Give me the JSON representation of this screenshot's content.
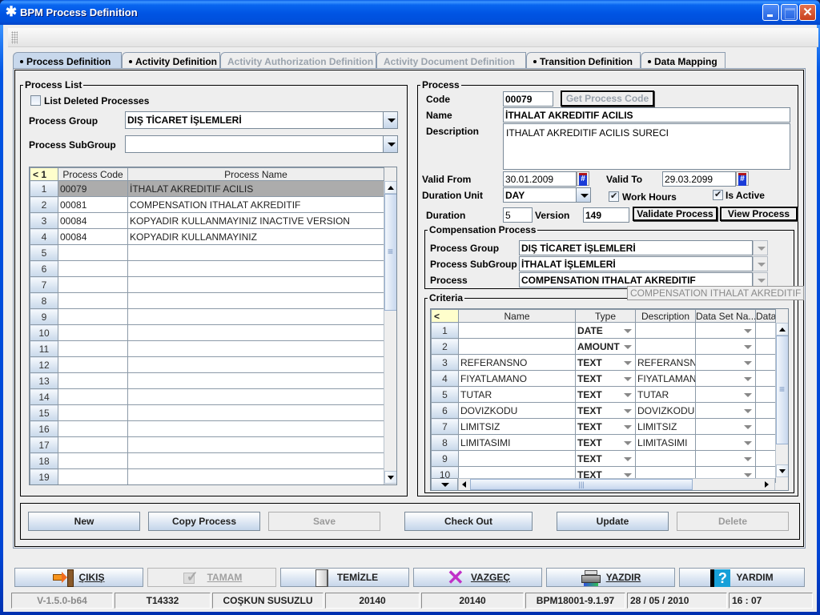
{
  "window": {
    "title": "BPM Process Definition",
    "controls": [
      "minimize",
      "maximize",
      "close"
    ]
  },
  "tabs": [
    {
      "label": "Process Definition",
      "state": "active"
    },
    {
      "label": "Activity Definition",
      "state": "enabled"
    },
    {
      "label": "Activity Authorization Definition",
      "state": "disabled"
    },
    {
      "label": "Activity Document Definition",
      "state": "disabled"
    },
    {
      "label": "Transition Definition",
      "state": "enabled"
    },
    {
      "label": "Data Mapping",
      "state": "enabled"
    }
  ],
  "process_list": {
    "legend": "Process List",
    "list_deleted_label": "List Deleted Processes",
    "list_deleted_checked": false,
    "group_label": "Process Group",
    "group_value": "DIŞ TİCARET İŞLEMLERİ",
    "subgroup_label": "Process SubGroup",
    "subgroup_value": "",
    "table": {
      "corner": "< 1",
      "columns": [
        "Process Code",
        "Process Name"
      ],
      "selected_row": 1,
      "rows": [
        {
          "n": "1",
          "code": "00079",
          "name": "İTHALAT AKREDITIF ACILIS"
        },
        {
          "n": "2",
          "code": "00081",
          "name": "COMPENSATION ITHALAT AKREDITIF"
        },
        {
          "n": "3",
          "code": "00084",
          "name": "KOPYADIR KULLANMAYINIZ INACTIVE VERSION"
        },
        {
          "n": "4",
          "code": "00084",
          "name": "KOPYADIR KULLANMAYINIZ"
        },
        {
          "n": "5",
          "code": "",
          "name": ""
        },
        {
          "n": "6",
          "code": "",
          "name": ""
        },
        {
          "n": "7",
          "code": "",
          "name": ""
        },
        {
          "n": "8",
          "code": "",
          "name": ""
        },
        {
          "n": "9",
          "code": "",
          "name": ""
        },
        {
          "n": "10",
          "code": "",
          "name": ""
        },
        {
          "n": "11",
          "code": "",
          "name": ""
        },
        {
          "n": "12",
          "code": "",
          "name": ""
        },
        {
          "n": "13",
          "code": "",
          "name": ""
        },
        {
          "n": "14",
          "code": "",
          "name": ""
        },
        {
          "n": "15",
          "code": "",
          "name": ""
        },
        {
          "n": "16",
          "code": "",
          "name": ""
        },
        {
          "n": "17",
          "code": "",
          "name": ""
        },
        {
          "n": "18",
          "code": "",
          "name": ""
        },
        {
          "n": "19",
          "code": "",
          "name": ""
        }
      ]
    }
  },
  "process": {
    "legend": "Process",
    "code_label": "Code",
    "code_value": "00079",
    "get_code_button": "Get Process Code",
    "name_label": "Name",
    "name_value": "İTHALAT AKREDITIF ACILIS",
    "description_label": "Description",
    "description_value": "ITHALAT AKREDITIF ACILIS SURECI",
    "valid_from_label": "Valid From",
    "valid_from_value": "30.01.2009",
    "valid_to_label": "Valid To",
    "valid_to_value": "29.03.2099",
    "duration_unit_label": "Duration Unit",
    "duration_unit_value": "DAY",
    "work_hours_label": "Work Hours",
    "work_hours_checked": true,
    "is_active_label": "Is Active",
    "is_active_checked": true,
    "duration_label": "Duration",
    "duration_value": "5",
    "version_label": "Version",
    "version_value": "149",
    "validate_button": "Validate Process",
    "view_button": "View Process"
  },
  "compensation": {
    "legend": "Compensation Process",
    "group_label": "Process Group",
    "group_value": "DIŞ TİCARET İŞLEMLERİ",
    "subgroup_label": "Process SubGroup",
    "subgroup_value": "İTHALAT İŞLEMLERİ",
    "process_label": "Process",
    "process_value": "COMPENSATION ITHALAT AKREDITIF",
    "tooltip": "COMPENSATION ITHALAT AKREDITIF"
  },
  "criteria": {
    "legend": "Criteria",
    "corner": "<",
    "columns": [
      "Name",
      "Type",
      "Description",
      "Data Set Na...",
      "Data"
    ],
    "rows": [
      {
        "n": "1",
        "name": "",
        "type": "DATE",
        "desc": "",
        "dataset": "",
        "data": ""
      },
      {
        "n": "2",
        "name": "",
        "type": "AMOUNT",
        "desc": "",
        "dataset": "",
        "data": ""
      },
      {
        "n": "3",
        "name": "REFERANSNO",
        "type": "TEXT",
        "desc": "REFERANSN",
        "dataset": "",
        "data": ""
      },
      {
        "n": "4",
        "name": "FIYATLAMANO",
        "type": "TEXT",
        "desc": "FIYATLAMAN",
        "dataset": "",
        "data": ""
      },
      {
        "n": "5",
        "name": "TUTAR",
        "type": "TEXT",
        "desc": "TUTAR",
        "dataset": "",
        "data": ""
      },
      {
        "n": "6",
        "name": "DOVIZKODU",
        "type": "TEXT",
        "desc": "DOVIZKODU",
        "dataset": "",
        "data": ""
      },
      {
        "n": "7",
        "name": "LIMITSIZ",
        "type": "TEXT",
        "desc": "LIMITSIZ",
        "dataset": "",
        "data": ""
      },
      {
        "n": "8",
        "name": "LIMITASIMI",
        "type": "TEXT",
        "desc": "LIMITASIMI",
        "dataset": "",
        "data": ""
      },
      {
        "n": "9",
        "name": "",
        "type": "TEXT",
        "desc": "",
        "dataset": "",
        "data": ""
      },
      {
        "n": "10",
        "name": "",
        "type": "TEXT",
        "desc": "",
        "dataset": "",
        "data": ""
      }
    ]
  },
  "actions": [
    {
      "label": "New",
      "enabled": true
    },
    {
      "label": "Copy Process",
      "enabled": true
    },
    {
      "label": "Save",
      "enabled": false
    },
    {
      "label": "Check Out",
      "enabled": true
    },
    {
      "label": "Update",
      "enabled": true
    },
    {
      "label": "Delete",
      "enabled": false
    }
  ],
  "bottom_buttons": [
    {
      "label": "ÇIKIŞ",
      "icon": "exit-door-icon",
      "enabled": true
    },
    {
      "label": "TAMAM",
      "icon": "checkmark-icon",
      "enabled": false
    },
    {
      "label": "TEMİZLE",
      "icon": "blank-page-icon",
      "enabled": true
    },
    {
      "label": "VAZGEÇ",
      "icon": "cancel-x-icon",
      "enabled": true
    },
    {
      "label": "YAZDIR",
      "icon": "printer-icon",
      "enabled": true
    },
    {
      "label": "YARDIM",
      "icon": "help-icon",
      "enabled": true
    }
  ],
  "status_bar": {
    "version": "V-1.5.0-b64",
    "user_code": "T14332",
    "user_name": "COŞKUN SUSUZLU",
    "branch1": "20140",
    "branch2": "20140",
    "screen_code": "BPM18001-9.1.97",
    "date": "28 / 05 / 2010",
    "time": "16 : 07"
  }
}
